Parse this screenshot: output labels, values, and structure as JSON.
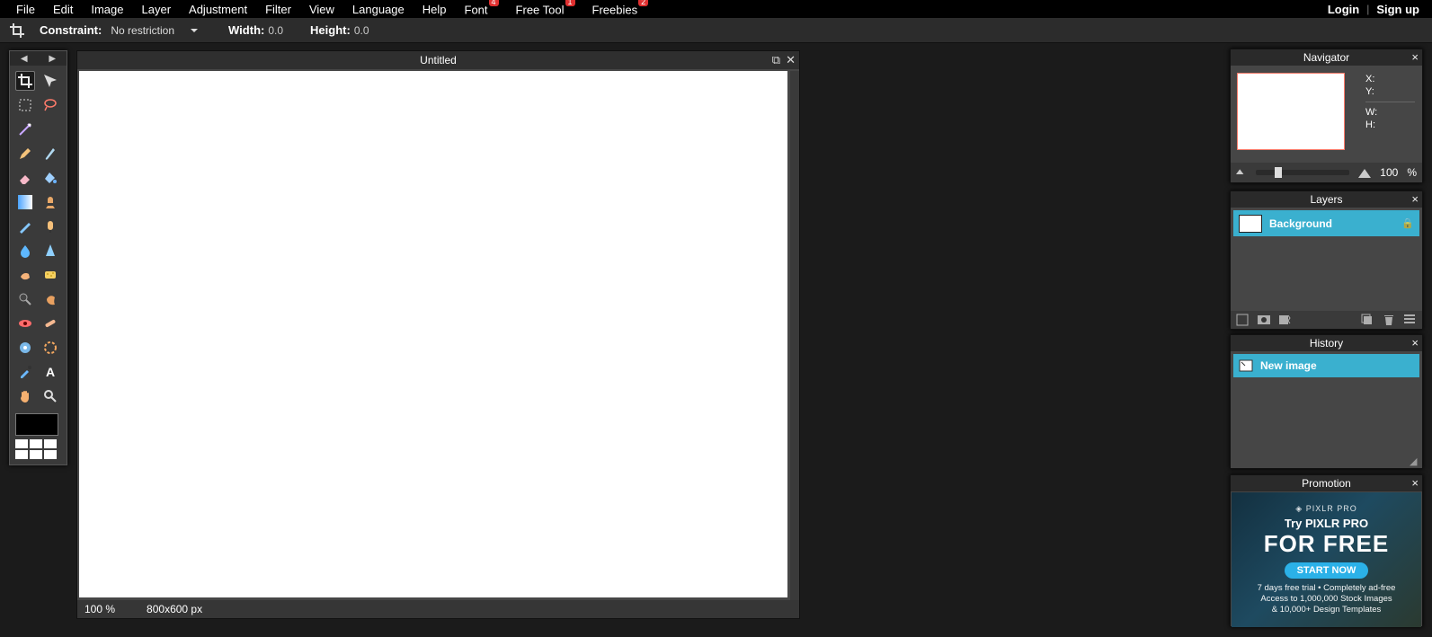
{
  "menu": {
    "file": "File",
    "edit": "Edit",
    "image": "Image",
    "layer": "Layer",
    "adjustment": "Adjustment",
    "filter": "Filter",
    "view": "View",
    "language": "Language",
    "help": "Help",
    "font": "Font",
    "font_badge": "4",
    "freetool": "Free Tool",
    "freetool_badge": "1",
    "freebies": "Freebies",
    "freebies_badge": "2"
  },
  "auth": {
    "login": "Login",
    "signup": "Sign up"
  },
  "options": {
    "constraint_label": "Constraint:",
    "constraint_value": "No restriction",
    "width_label": "Width:",
    "width_value": "0.0",
    "height_label": "Height:",
    "height_value": "0.0"
  },
  "canvas": {
    "title": "Untitled",
    "zoom": "100",
    "zoom_pct": "%",
    "dims": "800x600 px"
  },
  "navigator": {
    "title": "Navigator",
    "x": "X:",
    "y": "Y:",
    "w": "W:",
    "h": "H:",
    "zoom": "100",
    "pct": "%"
  },
  "layers": {
    "title": "Layers",
    "item": "Background"
  },
  "history": {
    "title": "History",
    "item": "New image"
  },
  "promotion": {
    "title": "Promotion",
    "brand": "◈ PIXLR PRO",
    "line1": "Try PIXLR PRO",
    "line2": "FOR FREE",
    "cta": "START NOW",
    "small1": "7 days free trial  •  Completely ad-free",
    "small2": "Access to 1,000,000 Stock Images",
    "small3": "& 10,000+ Design Templates"
  }
}
